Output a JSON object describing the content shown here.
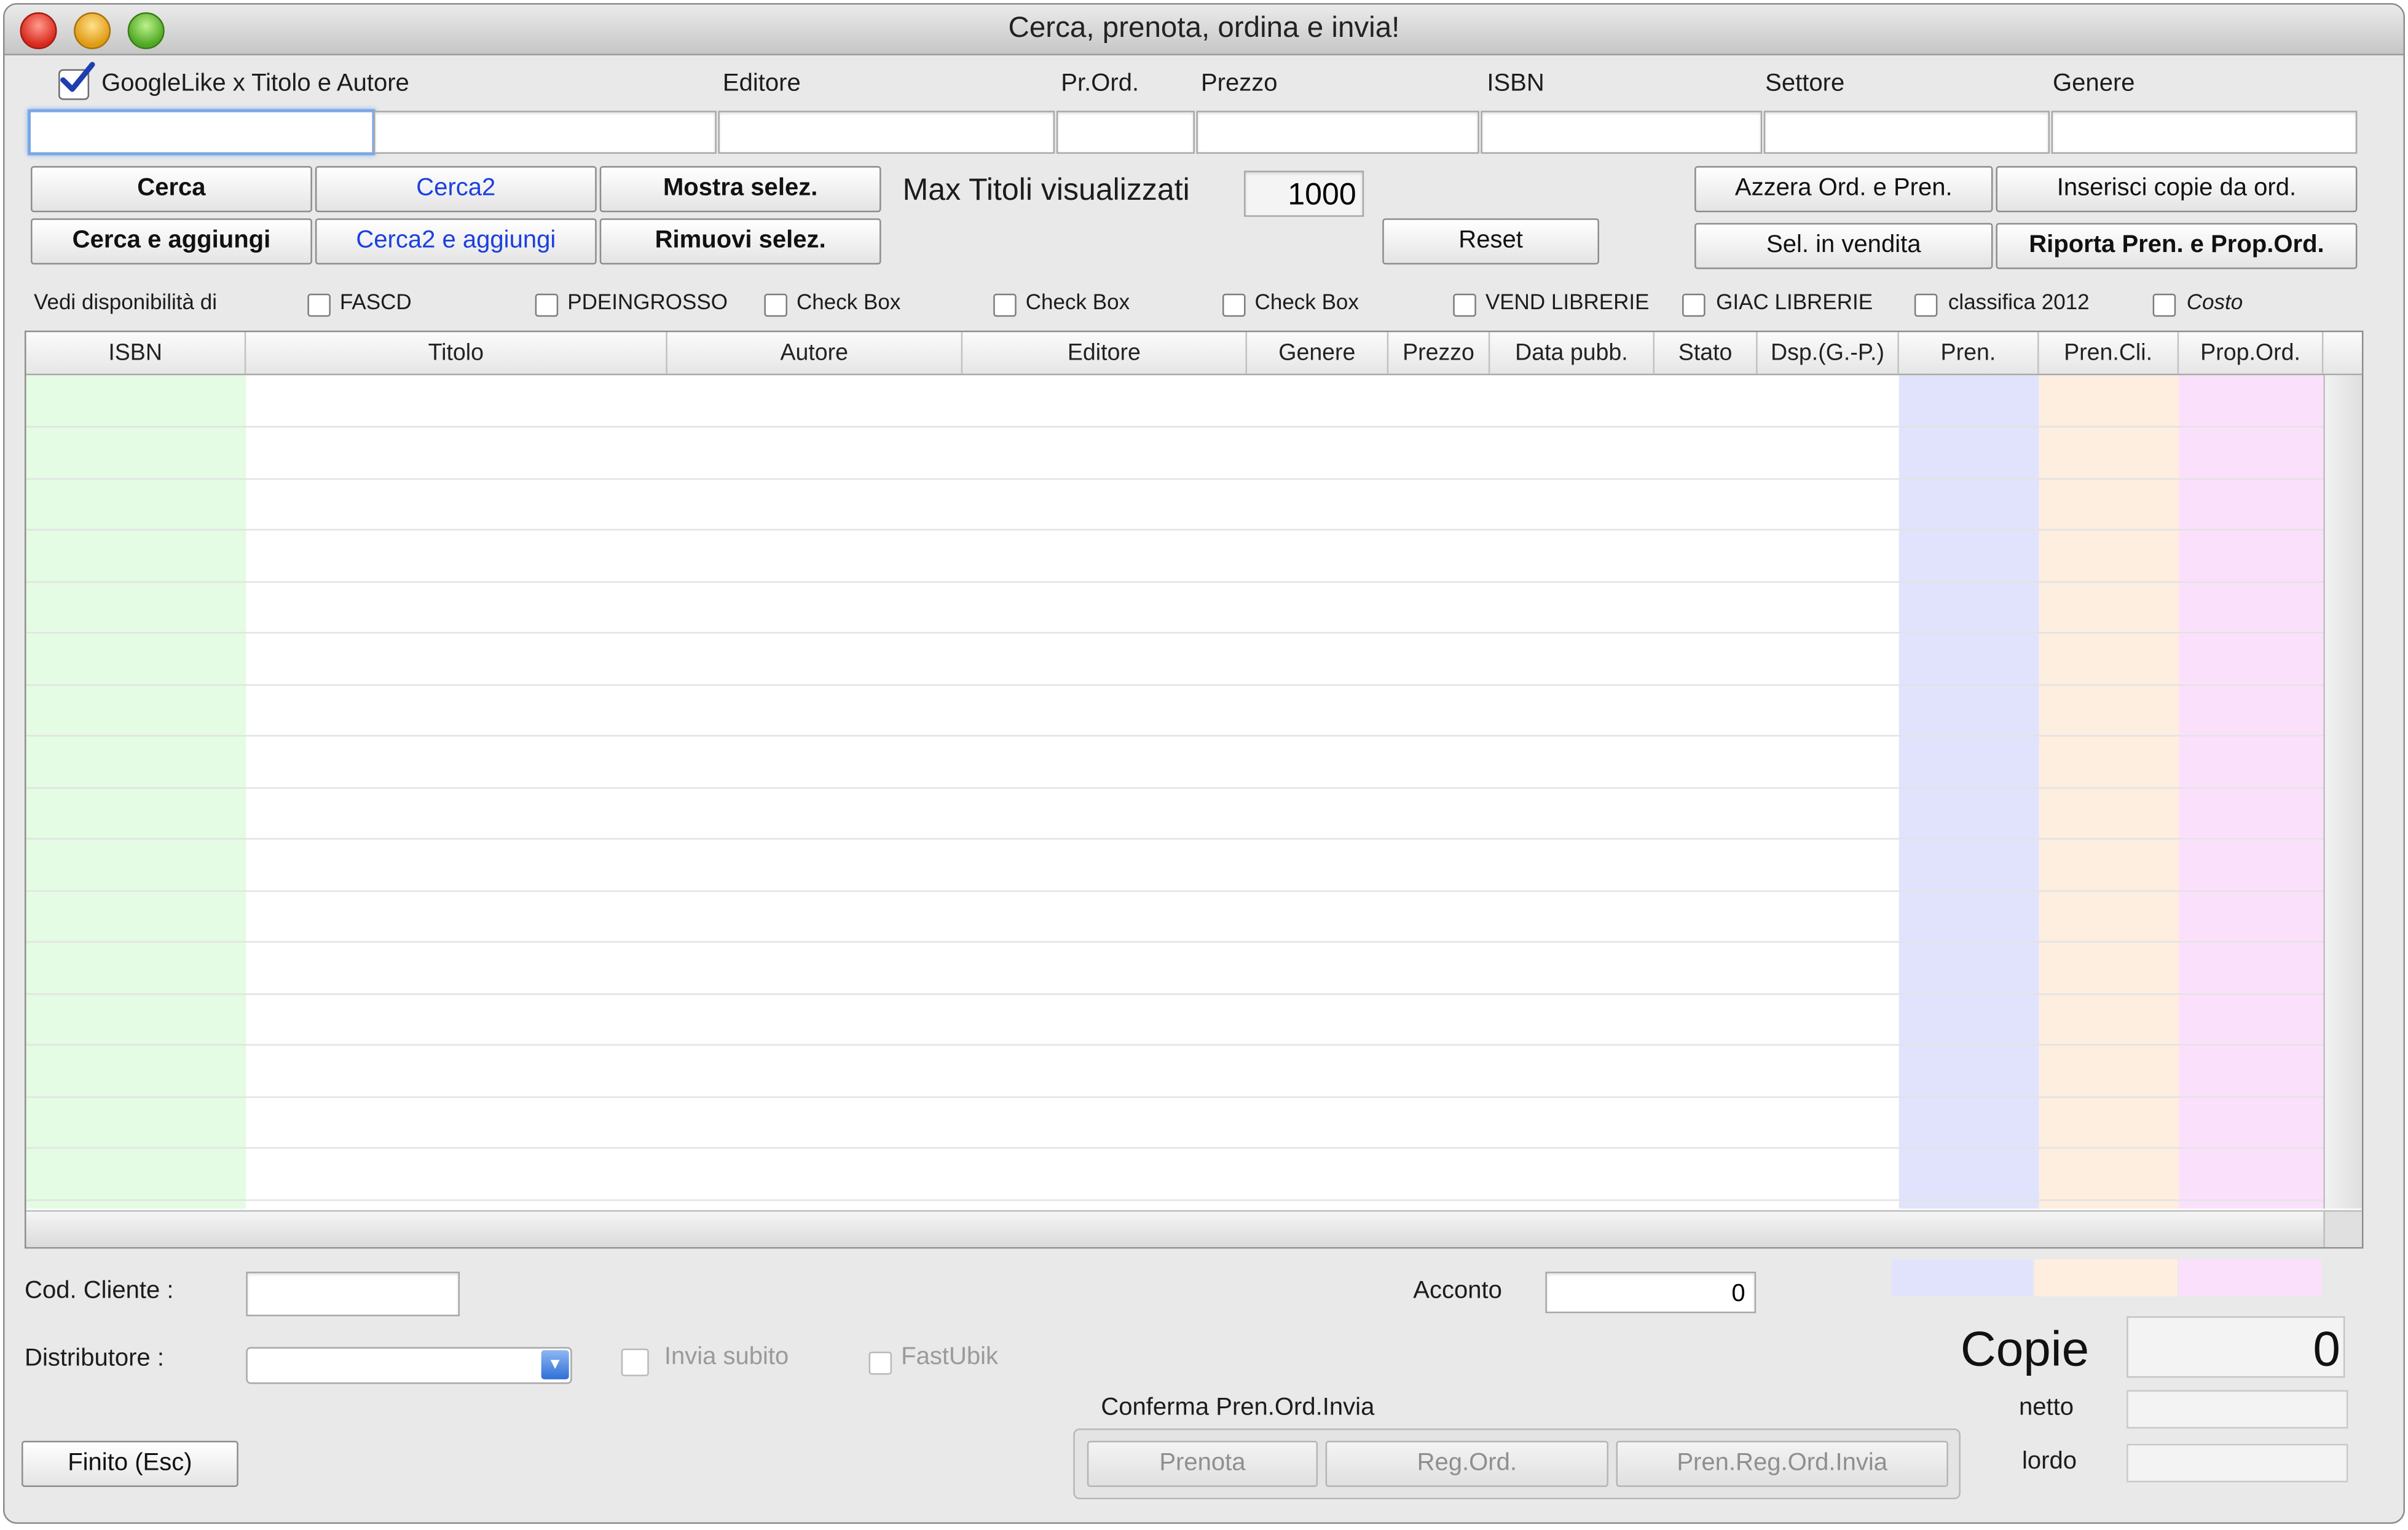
{
  "window": {
    "title": "Cerca, prenota, ordina e invia!"
  },
  "search": {
    "googlelike_label": "GoogleLike x Titolo e Autore",
    "googlelike_checked": true,
    "labels": {
      "editore": "Editore",
      "prord": "Pr.Ord.",
      "prezzo": "Prezzo",
      "isbn": "ISBN",
      "settore": "Settore",
      "genere": "Genere"
    }
  },
  "buttons": {
    "cerca": "Cerca",
    "cerca2": "Cerca2",
    "mostra_selez": "Mostra selez.",
    "cerca_aggiungi": "Cerca e aggiungi",
    "cerca2_aggiungi": "Cerca2 e aggiungi",
    "rimuovi_selez": "Rimuovi selez.",
    "reset": "Reset",
    "azzera": "Azzera Ord. e Pren.",
    "inserisci": "Inserisci copie da ord.",
    "sel_vendita": "Sel. in vendita",
    "riporta": "Riporta Pren. e Prop.Ord.",
    "finito": "Finito (Esc)",
    "prenota": "Prenota",
    "reg_ord": "Reg.Ord.",
    "pren_reg_ord_invia": "Pren.Reg.Ord.Invia"
  },
  "max_titoli": {
    "label": "Max Titoli visualizzati",
    "value": "1000"
  },
  "availability": {
    "label": "Vedi disponibilità di",
    "options": [
      "FASCD",
      "PDEINGROSSO",
      "Check Box",
      "Check Box",
      "Check Box",
      "VEND LIBRERIE",
      "GIAC LIBRERIE",
      "classifica 2012",
      "Costo"
    ]
  },
  "table": {
    "columns": [
      "ISBN",
      "Titolo",
      "Autore",
      "Editore",
      "Genere",
      "Prezzo",
      "Data pubb.",
      "Stato",
      "Dsp.(G.-P.)",
      "Pren.",
      "Pren.Cli.",
      "Prop.Ord."
    ]
  },
  "footer": {
    "cod_cliente_label": "Cod. Cliente :",
    "distributore_label": "Distributore :",
    "invia_subito": "Invia subito",
    "fastubik": "FastUbik",
    "acconto_label": "Acconto",
    "acconto_value": "0",
    "conferma_label": "Conferma Pren.Ord.Invia",
    "copie_label": "Copie",
    "copie_value": "0",
    "netto_label": "netto",
    "lordo_label": "lordo"
  },
  "colors": {
    "isbn_col": "#e4fbe4",
    "pren_col": "#e0e3fb",
    "pren_cli_col": "#fdeedf",
    "prop_ord_col": "#fbe0fb",
    "blue_text": "#1a3fe0"
  }
}
